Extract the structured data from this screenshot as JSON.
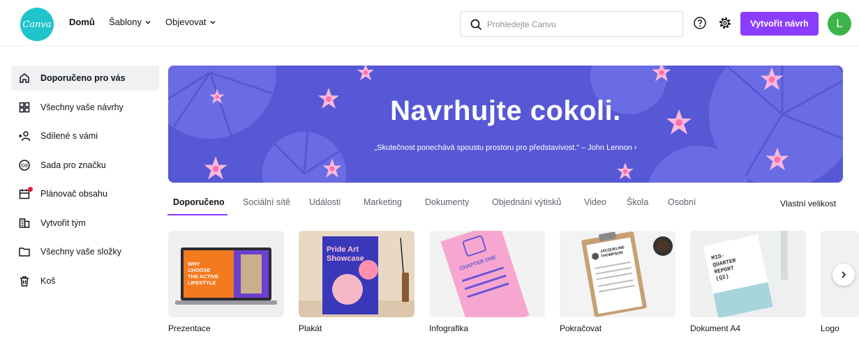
{
  "header": {
    "logo_text": "Canva",
    "nav": {
      "home": "Domů",
      "templates": "Šablony",
      "discover": "Objevovat"
    },
    "search_placeholder": "Prohledejte Canvu",
    "create_label": "Vytvořit návrh",
    "avatar_initial": "L",
    "icons": [
      "help-icon",
      "settings-icon",
      "search-icon"
    ]
  },
  "sidebar": {
    "items": [
      {
        "label": "Doporučeno pro vás",
        "icon": "home-icon",
        "active": true
      },
      {
        "label": "Všechny vaše návrhy",
        "icon": "grid-icon"
      },
      {
        "label": "Sdílené s vámi",
        "icon": "shared-users-icon"
      },
      {
        "label": "Sada pro značku",
        "icon": "brand-kit-icon"
      },
      {
        "label": "Plánovač obsahu",
        "icon": "calendar-icon",
        "notification": true
      },
      {
        "label": "Vytvořit tým",
        "icon": "team-icon"
      },
      {
        "label": "Všechny vaše složky",
        "icon": "folder-icon"
      },
      {
        "label": "Koš",
        "icon": "trash-icon"
      }
    ]
  },
  "banner": {
    "title": "Navrhujte cokoli.",
    "quote": "„Skutečnost ponechává spoustu prostoru pro představivost.“ – John Lennon ›",
    "background_color": "#5658d6"
  },
  "tabs": {
    "items": [
      "Doporučeno",
      "Sociální sítě",
      "Události",
      "Marketing",
      "Dokumenty",
      "Objednání výtisků",
      "Video",
      "Škola",
      "Osobní"
    ],
    "active_index": 0,
    "custom_size": "Vlastní velikost"
  },
  "cards": [
    {
      "label": "Prezentace",
      "thumb_text": "WHY CHOOSE THE ACTIVE LIFESTYLE"
    },
    {
      "label": "Plakát",
      "thumb_text": "Pride Art Showcase"
    },
    {
      "label": "Infografika",
      "thumb_text": "CHAPTER ONE"
    },
    {
      "label": "Pokračovat",
      "thumb_text": "JACQUELINE THOMPSON"
    },
    {
      "label": "Dokument A4",
      "thumb_text": "MID-QUARTER REPORT (Q2)"
    },
    {
      "label": "Logo"
    }
  ],
  "colors": {
    "accent": "#8b3dff",
    "logo": "#20c4cb",
    "avatar": "#3cb44b"
  }
}
